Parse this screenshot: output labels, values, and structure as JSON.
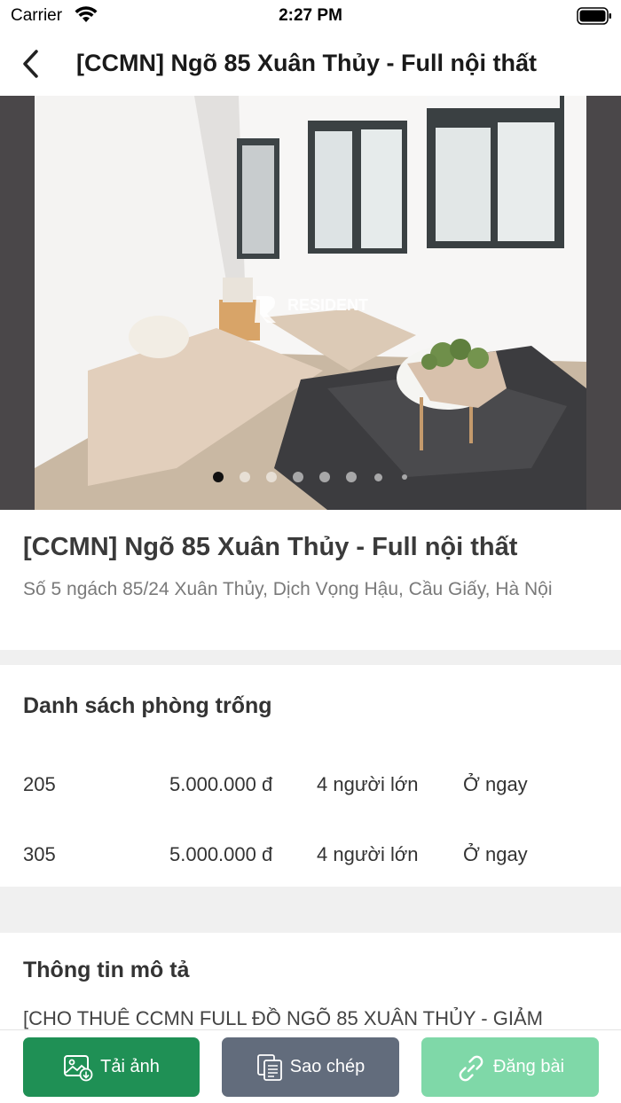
{
  "status_bar": {
    "carrier": "Carrier",
    "time": "2:27 PM"
  },
  "nav": {
    "title": "[CCMN] Ngõ 85 Xuân Thủy - Full nội thất"
  },
  "gallery": {
    "watermark": "RESIDENT",
    "total_images": 8,
    "active_index": 0
  },
  "listing": {
    "name": "[CCMN] Ngõ 85 Xuân Thủy - Full nội thất",
    "address": "Số 5 ngách 85/24 Xuân Thủy, Dịch Vọng Hậu, Cầu Giấy, Hà Nội"
  },
  "rooms": {
    "heading": "Danh sách phòng trống",
    "items": [
      {
        "number": "205",
        "price": "5.000.000 đ",
        "capacity": "4 người lớn",
        "availability": "Ở ngay"
      },
      {
        "number": "305",
        "price": "5.000.000 đ",
        "capacity": "4 người lớn",
        "availability": "Ở ngay"
      }
    ]
  },
  "description": {
    "heading": "Thông tin mô tả",
    "first_line": "[CHO THUÊ CCMN FULL ĐỒ NGÕ 85 XUÂN THỦY - GIẢM"
  },
  "actions": {
    "download_label": "Tải ảnh",
    "copy_label": "Sao chép",
    "post_label": "Đăng bài"
  },
  "colors": {
    "download": "#1f9055",
    "copy": "#626c7c",
    "post": "#7fd8a8"
  }
}
